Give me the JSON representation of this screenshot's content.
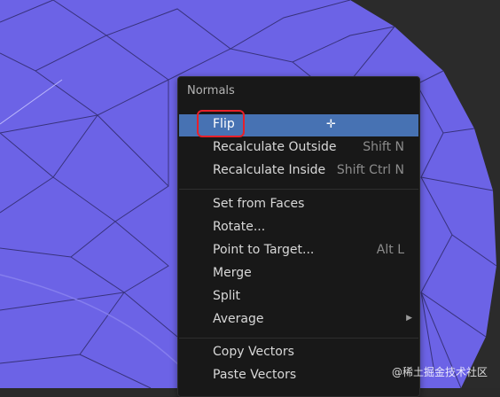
{
  "colors": {
    "mesh_fill": "#6c63e6",
    "mesh_edges": "#2f2a6a",
    "menu_bg": "#181818",
    "highlight": "#4772b3",
    "annotation": "#e8202a"
  },
  "menu": {
    "title": "Normals",
    "items": [
      {
        "label": "Flip",
        "shortcut": "",
        "highlighted": true,
        "cursor_icon": "crosshair-cursor-icon"
      },
      {
        "label": "Recalculate Outside",
        "shortcut": "Shift N"
      },
      {
        "label": "Recalculate Inside",
        "shortcut": "Shift Ctrl N"
      },
      {
        "label": "Set from Faces",
        "shortcut": ""
      },
      {
        "label": "Rotate...",
        "shortcut": ""
      },
      {
        "label": "Point to Target...",
        "shortcut": "Alt L"
      },
      {
        "label": "Merge",
        "shortcut": ""
      },
      {
        "label": "Split",
        "shortcut": ""
      },
      {
        "label": "Average",
        "shortcut": "",
        "submenu": "submenu-arrow-icon"
      },
      {
        "label": "Copy Vectors",
        "shortcut": ""
      },
      {
        "label": "Paste Vectors",
        "shortcut": ""
      }
    ]
  },
  "watermark": "@稀土掘金技术社区"
}
